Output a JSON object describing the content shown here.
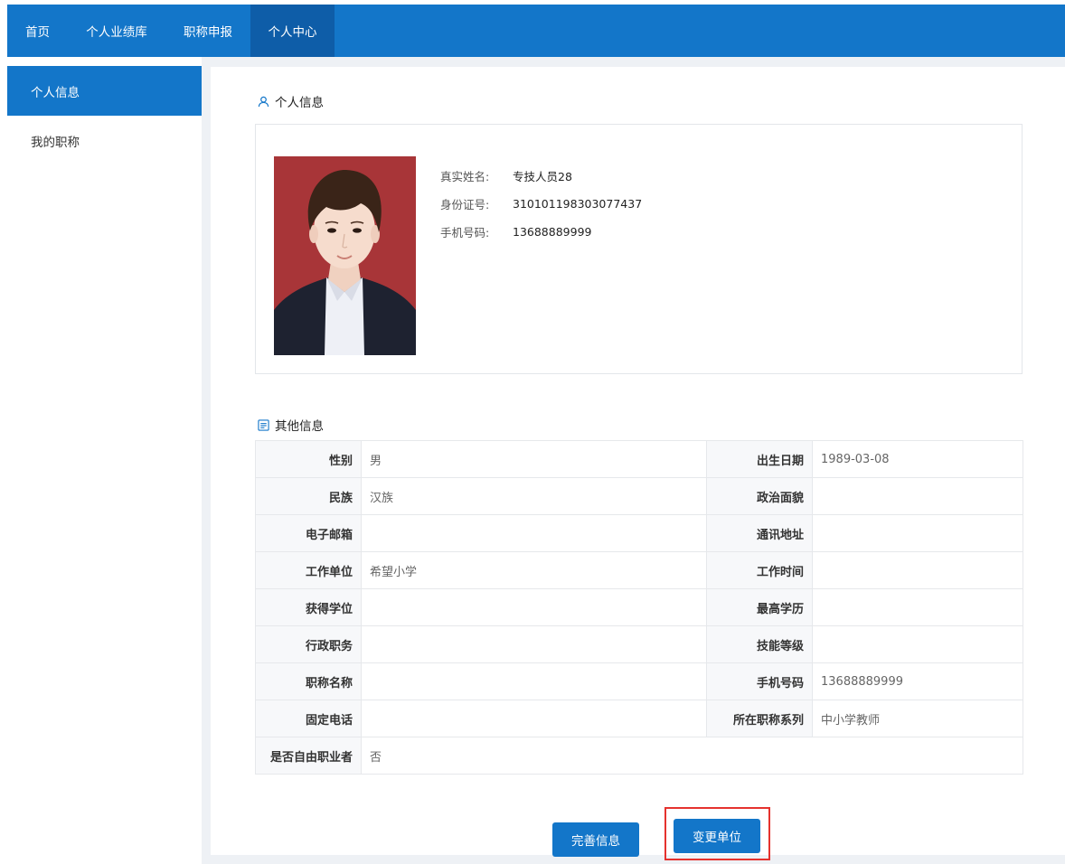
{
  "nav": {
    "items": [
      {
        "label": "首页"
      },
      {
        "label": "个人业绩库"
      },
      {
        "label": "职称申报"
      },
      {
        "label": "个人中心",
        "active": true
      }
    ]
  },
  "sidebar": {
    "items": [
      {
        "label": "个人信息",
        "active": true
      },
      {
        "label": "我的职称"
      }
    ]
  },
  "personal": {
    "title": "个人信息",
    "icon": "user-icon",
    "fields": [
      {
        "label": "真实姓名:",
        "value": "专技人员28"
      },
      {
        "label": "身份证号:",
        "value": "310101198303077437"
      },
      {
        "label": "手机号码:",
        "value": "13688889999"
      }
    ]
  },
  "other": {
    "title": "其他信息",
    "icon": "document-icon",
    "rows": [
      {
        "k1": "性别",
        "v1": "男",
        "k2": "出生日期",
        "v2": "1989-03-08"
      },
      {
        "k1": "民族",
        "v1": "汉族",
        "k2": "政治面貌",
        "v2": ""
      },
      {
        "k1": "电子邮箱",
        "v1": "",
        "k2": "通讯地址",
        "v2": ""
      },
      {
        "k1": "工作单位",
        "v1": "希望小学",
        "k2": "工作时间",
        "v2": ""
      },
      {
        "k1": "获得学位",
        "v1": "",
        "k2": "最高学历",
        "v2": ""
      },
      {
        "k1": "行政职务",
        "v1": "",
        "k2": "技能等级",
        "v2": ""
      },
      {
        "k1": "职称名称",
        "v1": "",
        "k2": "手机号码",
        "v2": "13688889999"
      },
      {
        "k1": "固定电话",
        "v1": "",
        "k2": "所在职称系列",
        "v2": "中小学教师"
      }
    ],
    "last_row": {
      "k": "是否自由职业者",
      "v": "否"
    }
  },
  "buttons": {
    "complete_label": "完善信息",
    "change_label": "变更单位"
  },
  "colors": {
    "primary": "#1376c9",
    "primary_dark": "#0e5da8",
    "highlight": "#e5322e"
  }
}
